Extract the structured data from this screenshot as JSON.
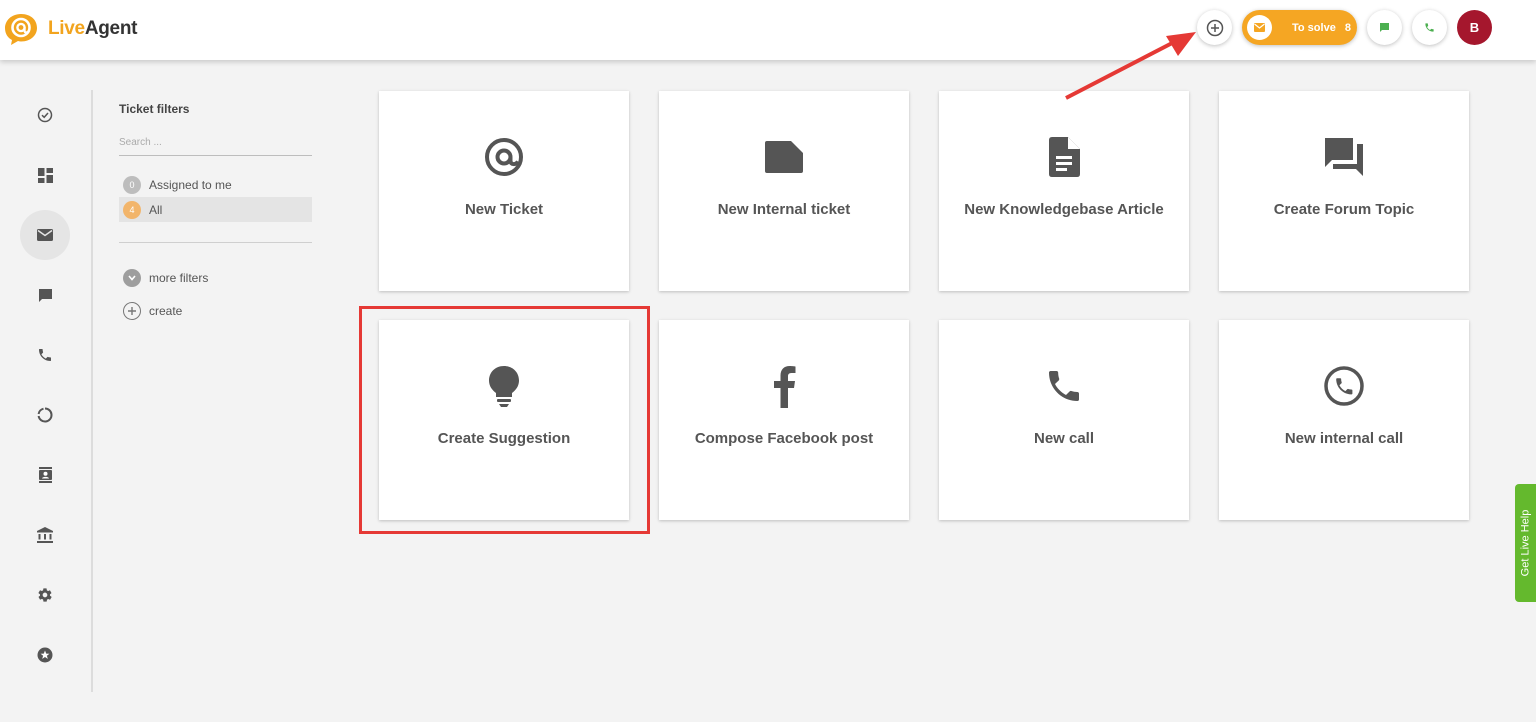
{
  "app": {
    "brand_live": "Live",
    "brand_agent": "Agent"
  },
  "header": {
    "to_solve_label": "To solve",
    "to_solve_count": "8",
    "avatar_initial": "B"
  },
  "sidebar": {
    "items": [
      {
        "icon": "check-circle-icon"
      },
      {
        "icon": "dashboard-icon"
      },
      {
        "icon": "envelope-icon",
        "active": true
      },
      {
        "icon": "chat-icon"
      },
      {
        "icon": "phone-icon"
      },
      {
        "icon": "reports-icon"
      },
      {
        "icon": "contacts-icon"
      },
      {
        "icon": "knowledgebase-icon"
      },
      {
        "icon": "gear-icon"
      },
      {
        "icon": "star-icon"
      }
    ]
  },
  "filters": {
    "title": "Ticket filters",
    "search_placeholder": "Search ...",
    "items": [
      {
        "count": "0",
        "label": "Assigned to me"
      },
      {
        "count": "4",
        "label": "All"
      }
    ],
    "more_label": "more filters",
    "create_label": "create"
  },
  "tiles": [
    {
      "label": "New Ticket",
      "icon": "at-icon"
    },
    {
      "label": "New Internal ticket",
      "icon": "note-icon"
    },
    {
      "label": "New Knowledgebase Article",
      "icon": "document-icon"
    },
    {
      "label": "Create Forum Topic",
      "icon": "forum-icon"
    },
    {
      "label": "Create Suggestion",
      "icon": "lightbulb-icon"
    },
    {
      "label": "Compose Facebook post",
      "icon": "facebook-icon"
    },
    {
      "label": "New call",
      "icon": "phone-icon"
    },
    {
      "label": "New internal call",
      "icon": "internal-call-icon"
    }
  ],
  "live_help": "Get Live Help",
  "colors": {
    "brand_orange": "#f2a41e",
    "to_solve_bg": "#f5a623",
    "avatar_bg": "#a5172d",
    "annotation_red": "#e53935",
    "live_help_green": "#64b92d"
  }
}
